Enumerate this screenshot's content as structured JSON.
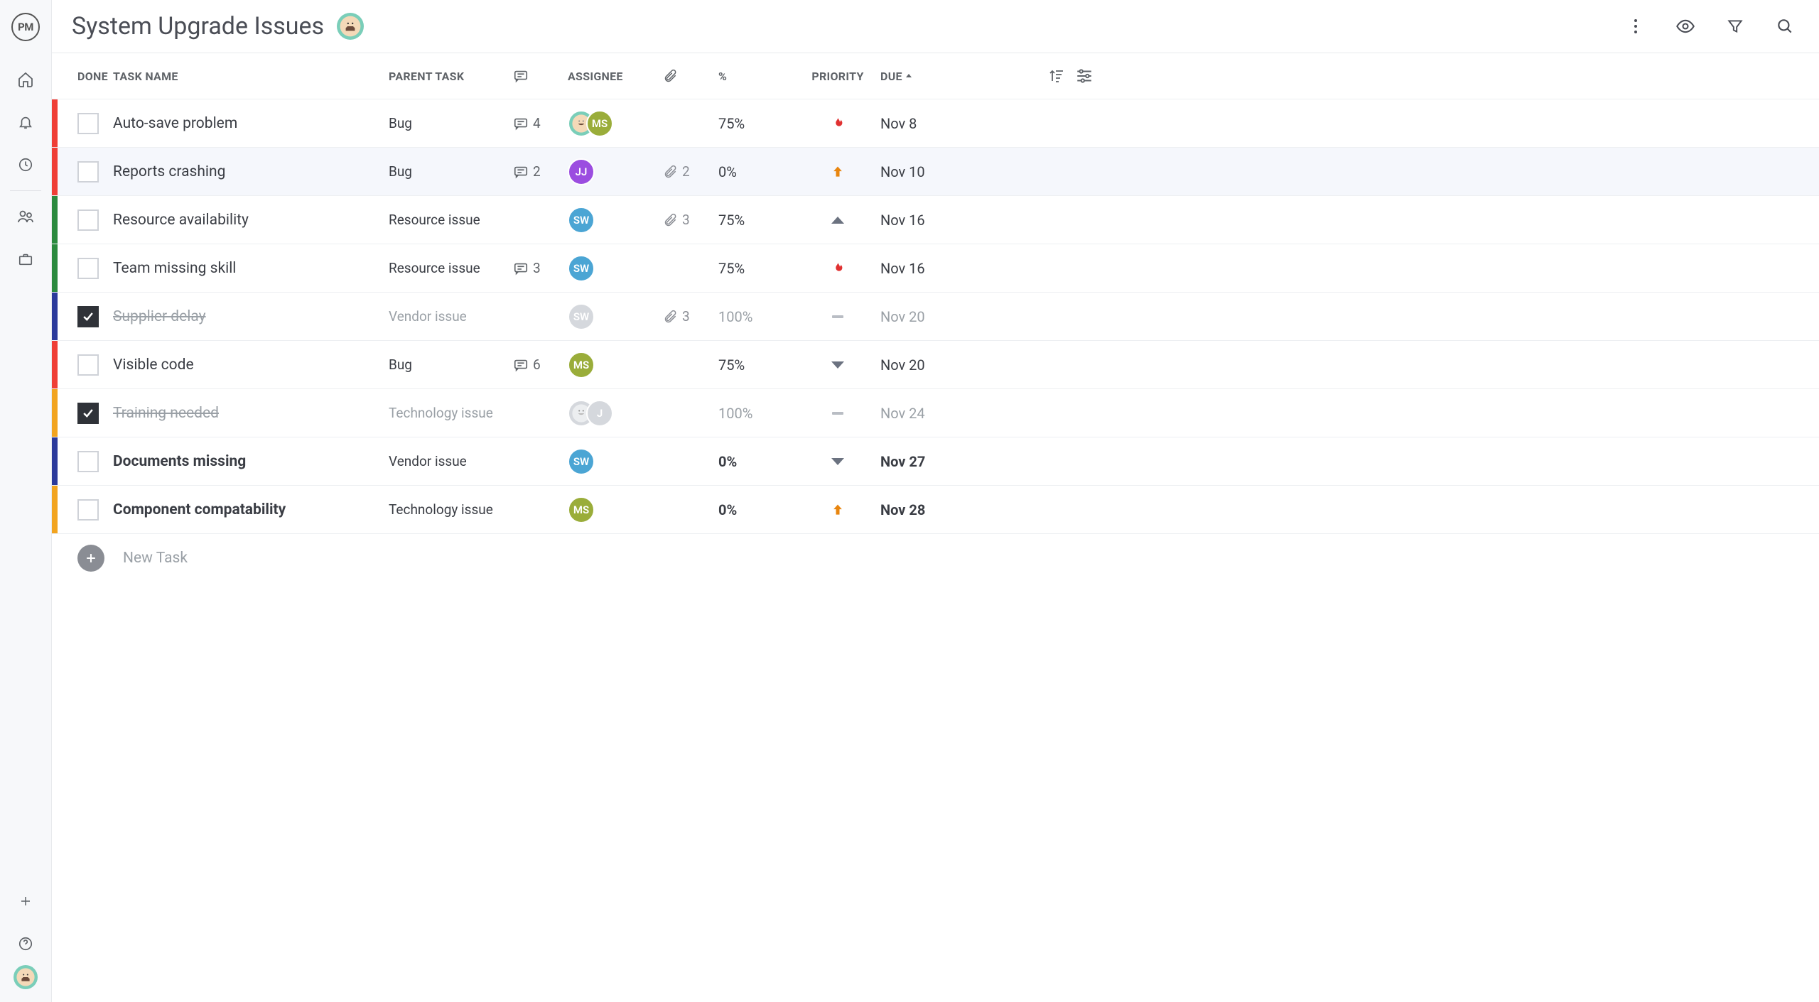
{
  "logo": "PM",
  "title": "System Upgrade Issues",
  "columns": {
    "done": "DONE",
    "task": "TASK NAME",
    "parent": "PARENT TASK",
    "assignee": "ASSIGNEE",
    "percent": "%",
    "priority": "PRIORITY",
    "due": "DUE"
  },
  "colors": {
    "red": "#ef3e36",
    "green": "#2b8a3e",
    "navy": "#2b3a9b",
    "orange": "#f2a41f"
  },
  "priority_icons": {
    "critical": "flame",
    "high": "arrow-up",
    "medium": "triangle-up",
    "low": "triangle-down",
    "none": "dash"
  },
  "rows": [
    {
      "color": "red",
      "done": false,
      "name": "Auto-save problem",
      "parent": "Bug",
      "comments": 4,
      "assignees": [
        "jwant",
        "ms"
      ],
      "attachments": null,
      "percent": "75%",
      "priority": "critical",
      "due": "Nov 8",
      "bold": false,
      "hover": false
    },
    {
      "color": "red",
      "done": false,
      "name": "Reports crashing",
      "parent": "Bug",
      "comments": 2,
      "assignees": [
        "jj"
      ],
      "attachments": 2,
      "percent": "0%",
      "priority": "high",
      "due": "Nov 10",
      "bold": false,
      "hover": true
    },
    {
      "color": "green",
      "done": false,
      "name": "Resource availability",
      "parent": "Resource issue",
      "comments": null,
      "assignees": [
        "sw"
      ],
      "attachments": 3,
      "percent": "75%",
      "priority": "medium",
      "due": "Nov 16",
      "bold": false,
      "hover": false
    },
    {
      "color": "green",
      "done": false,
      "name": "Team missing skill",
      "parent": "Resource issue",
      "comments": 3,
      "assignees": [
        "sw"
      ],
      "attachments": null,
      "percent": "75%",
      "priority": "critical",
      "due": "Nov 16",
      "bold": false,
      "hover": false
    },
    {
      "color": "navy",
      "done": true,
      "name": "Supplier delay",
      "parent": "Vendor issue",
      "comments": null,
      "assignees": [
        "grey-sw"
      ],
      "attachments": 3,
      "percent": "100%",
      "priority": "none",
      "due": "Nov 20",
      "bold": false,
      "hover": false
    },
    {
      "color": "red",
      "done": false,
      "name": "Visible code",
      "parent": "Bug",
      "comments": 6,
      "assignees": [
        "ms"
      ],
      "attachments": null,
      "percent": "75%",
      "priority": "low",
      "due": "Nov 20",
      "bold": false,
      "hover": false
    },
    {
      "color": "orange",
      "done": true,
      "name": "Training needed",
      "parent": "Technology issue",
      "comments": null,
      "assignees": [
        "grey-jwant",
        "grey-j"
      ],
      "attachments": null,
      "percent": "100%",
      "priority": "none",
      "due": "Nov 24",
      "bold": false,
      "hover": false
    },
    {
      "color": "navy",
      "done": false,
      "name": "Documents missing",
      "parent": "Vendor issue",
      "comments": null,
      "assignees": [
        "sw"
      ],
      "attachments": null,
      "percent": "0%",
      "priority": "low",
      "due": "Nov 27",
      "bold": true,
      "hover": false
    },
    {
      "color": "orange",
      "done": false,
      "name": "Component compatability",
      "parent": "Technology issue",
      "comments": null,
      "assignees": [
        "ms"
      ],
      "attachments": null,
      "percent": "0%",
      "priority": "high",
      "due": "Nov 28",
      "bold": true,
      "hover": false
    }
  ],
  "new_task": "New Task"
}
